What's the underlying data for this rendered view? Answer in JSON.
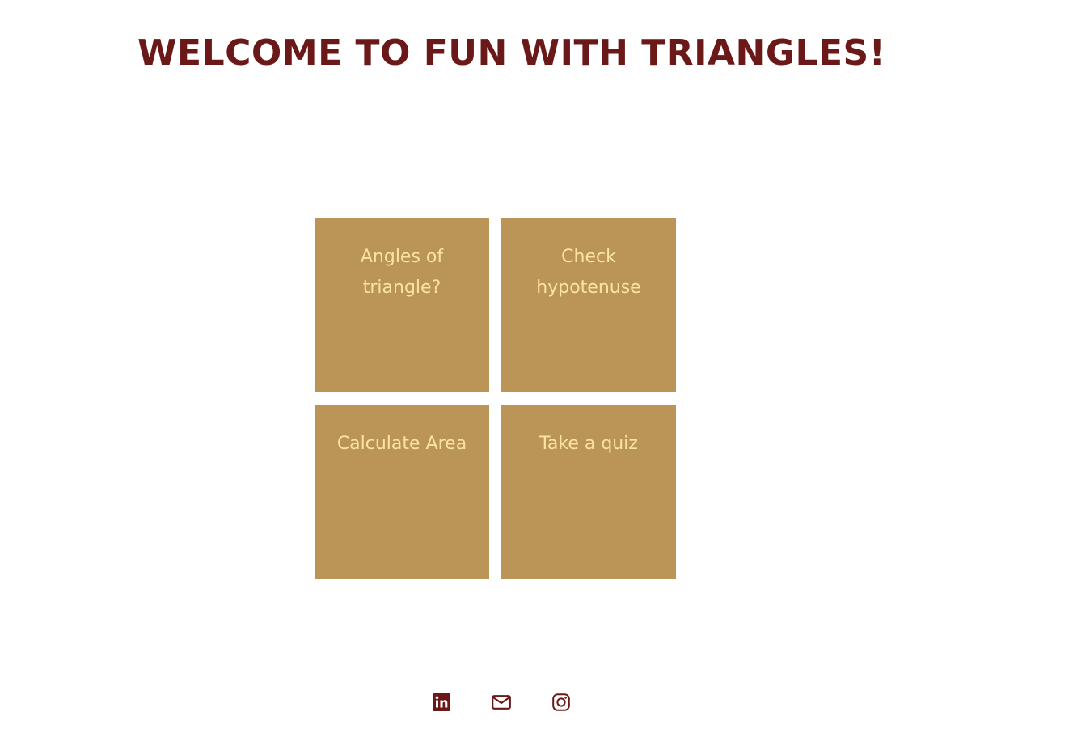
{
  "header": {
    "title": "WELCOME TO FUN WITH TRIANGLES!"
  },
  "tiles": [
    {
      "label": "Angles of triangle?"
    },
    {
      "label": "Check hypotenuse"
    },
    {
      "label": "Calculate Area"
    },
    {
      "label": "Take a quiz"
    }
  ],
  "footer": {
    "icons": [
      "linkedin-icon",
      "email-icon",
      "instagram-icon"
    ]
  },
  "colors": {
    "title": "#6b1818",
    "tile_background": "#bb9557",
    "tile_text": "#fbe3a3",
    "icon": "#6b1818"
  }
}
